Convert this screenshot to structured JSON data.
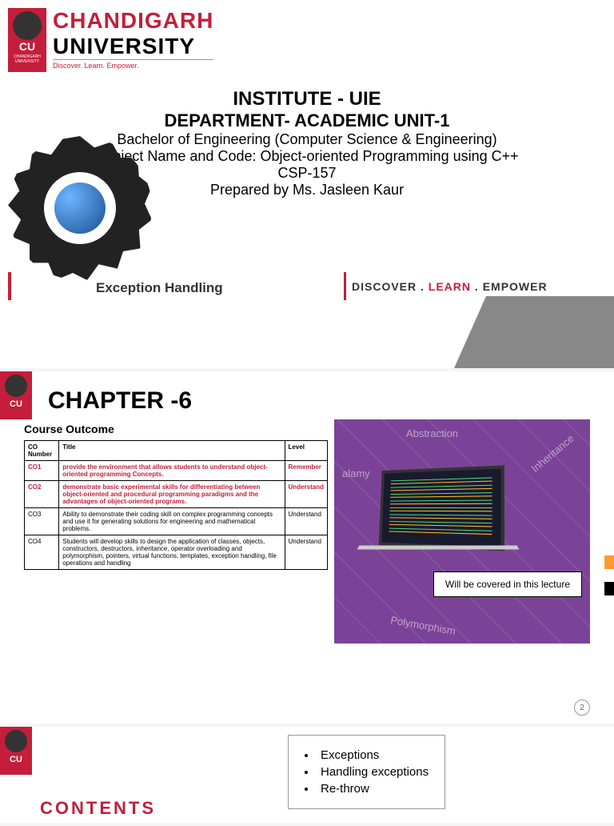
{
  "university": {
    "name": "CHANDIGARH",
    "subname": "UNIVERSITY",
    "tagline": "Discover. Learn. Empower.",
    "badge_text": "CU",
    "badge_sub": "CHANDIGARH UNIVERSITY"
  },
  "slide1": {
    "institute": "INSTITUTE - UIE",
    "department": "DEPARTMENT- ACADEMIC UNIT-1",
    "degree": "Bachelor of Engineering (Computer Science & Engineering)",
    "subject": "Subject Name and Code: Object-oriented Programming using C++",
    "code": "CSP-157",
    "prepared": "Prepared by Ms. Jasleen Kaur",
    "topic": "Exception Handling",
    "dle_discover": "DISCOVER . ",
    "dle_learn": "LEARN",
    "dle_empower": " . EMPOWER"
  },
  "slide2": {
    "chapter": "CHAPTER -6",
    "outcome_title": "Course Outcome",
    "headers": {
      "num": "CO Number",
      "title": "Title",
      "level": "Level"
    },
    "rows": [
      {
        "num": "CO1",
        "title": "provide the environment that allows students to understand object-oriented programming Concepts.",
        "level": "Remember",
        "red": true
      },
      {
        "num": "CO2",
        "title": "demonstrate basic experimental skills for differentiating between object-oriented and procedural programming paradigms and the advantages of object-oriented programs.",
        "level": "Understand",
        "red": true
      },
      {
        "num": "CO3",
        "title": "Ability to demonstrate their coding skill on complex programming concepts and use it for generating solutions for engineering and mathematical problems.",
        "level": "Understand",
        "red": false
      },
      {
        "num": "CO4",
        "title": "Students will develop skills to design the application of classes, objects, constructors, destructors, inheritance, operator overloading and polymorphism, pointers, virtual functions, templates, exception handling, file operations and handling",
        "level": "Understand",
        "red": false
      }
    ],
    "oop_labels": [
      "Abstraction",
      "Inheritance",
      "Polymorphism",
      "alamy"
    ],
    "callout": "Will be covered in this lecture",
    "page": "2"
  },
  "slide3": {
    "contents_title": "CONTENTS",
    "items": [
      "Exceptions",
      "Handling exceptions",
      "Re-throw"
    ]
  }
}
